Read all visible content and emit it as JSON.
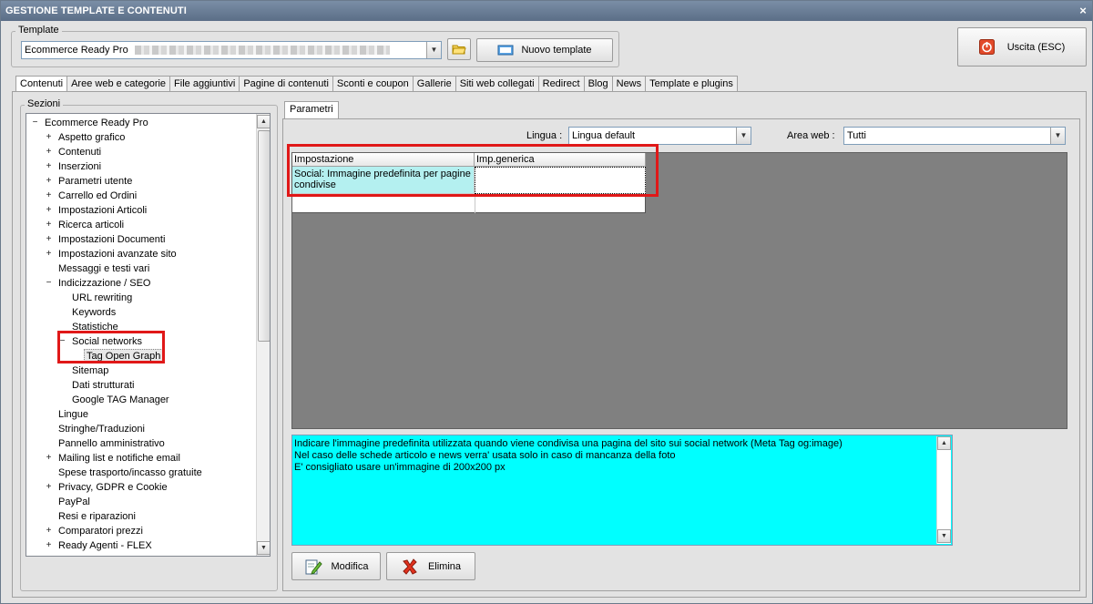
{
  "window": {
    "title": "GESTIONE TEMPLATE E CONTENUTI",
    "close_symbol": "×"
  },
  "template_group": {
    "legend": "Template",
    "combo_value": "Ecommerce Ready Pro",
    "new_template_label": "Nuovo template"
  },
  "exit_button": {
    "label": "Uscita (ESC)"
  },
  "tabs": [
    {
      "label": "Contenuti",
      "active": true
    },
    {
      "label": "Aree web e categorie"
    },
    {
      "label": "File aggiuntivi"
    },
    {
      "label": "Pagine di contenuti"
    },
    {
      "label": "Sconti e coupon"
    },
    {
      "label": "Gallerie"
    },
    {
      "label": "Siti web collegati"
    },
    {
      "label": "Redirect"
    },
    {
      "label": "Blog"
    },
    {
      "label": "News"
    },
    {
      "label": "Template e plugins"
    }
  ],
  "sections": {
    "legend": "Sezioni",
    "tree": [
      {
        "label": "Ecommerce Ready Pro",
        "level": 0,
        "expander": "−"
      },
      {
        "label": "Aspetto grafico",
        "level": 1,
        "expander": "+"
      },
      {
        "label": "Contenuti",
        "level": 1,
        "expander": "+"
      },
      {
        "label": "Inserzioni",
        "level": 1,
        "expander": "+"
      },
      {
        "label": "Parametri utente",
        "level": 1,
        "expander": "+"
      },
      {
        "label": "Carrello ed Ordini",
        "level": 1,
        "expander": "+"
      },
      {
        "label": "Impostazioni Articoli",
        "level": 1,
        "expander": "+"
      },
      {
        "label": "Ricerca articoli",
        "level": 1,
        "expander": "+"
      },
      {
        "label": "Impostazioni Documenti",
        "level": 1,
        "expander": "+"
      },
      {
        "label": "Impostazioni avanzate sito",
        "level": 1,
        "expander": "+"
      },
      {
        "label": "Messaggi e testi vari",
        "level": 1,
        "expander": ""
      },
      {
        "label": "Indicizzazione / SEO",
        "level": 1,
        "expander": "−"
      },
      {
        "label": "URL rewriting",
        "level": 2,
        "expander": ""
      },
      {
        "label": "Keywords",
        "level": 2,
        "expander": ""
      },
      {
        "label": "Statistiche",
        "level": 2,
        "expander": ""
      },
      {
        "label": "Social networks",
        "level": 2,
        "expander": "−"
      },
      {
        "label": "Tag Open Graph",
        "level": 3,
        "expander": "",
        "selected": true
      },
      {
        "label": "Sitemap",
        "level": 2,
        "expander": ""
      },
      {
        "label": "Dati strutturati",
        "level": 2,
        "expander": ""
      },
      {
        "label": "Google TAG Manager",
        "level": 2,
        "expander": ""
      },
      {
        "label": "Lingue",
        "level": 1,
        "expander": ""
      },
      {
        "label": "Stringhe/Traduzioni",
        "level": 1,
        "expander": ""
      },
      {
        "label": "Pannello amministrativo",
        "level": 1,
        "expander": ""
      },
      {
        "label": "Mailing list e notifiche email",
        "level": 1,
        "expander": "+"
      },
      {
        "label": "Spese trasporto/incasso gratuite",
        "level": 1,
        "expander": ""
      },
      {
        "label": "Privacy, GDPR e Cookie",
        "level": 1,
        "expander": "+"
      },
      {
        "label": "PayPal",
        "level": 1,
        "expander": ""
      },
      {
        "label": "Resi e riparazioni",
        "level": 1,
        "expander": ""
      },
      {
        "label": "Comparatori prezzi",
        "level": 1,
        "expander": "+"
      },
      {
        "label": "Ready Agenti - FLEX",
        "level": 1,
        "expander": "+"
      }
    ]
  },
  "params": {
    "tab_label": "Parametri",
    "lingua_label": "Lingua :",
    "lingua_value": "Lingua default",
    "area_label": "Area web :",
    "area_value": "Tutti",
    "grid": {
      "columns": [
        "Impostazione",
        "Imp.generica"
      ],
      "rows": [
        {
          "impostazione": "Social: Immagine predefinita per pagine condivise",
          "imp_generica": ""
        }
      ]
    },
    "description": [
      "Indicare l'immagine predefinita utilizzata quando viene condivisa una pagina del sito sui social network (Meta Tag og:image)",
      "Nel caso delle schede articolo e news verra' usata solo in caso di mancanza della foto",
      "E' consigliato usare un'immagine di 200x200 px"
    ],
    "modify_label": "Modifica",
    "delete_label": "Elimina"
  },
  "colors": {
    "highlight": "#e01818",
    "description_bg": "#00ffff",
    "selected_row_bg": "#b4f0f0"
  }
}
